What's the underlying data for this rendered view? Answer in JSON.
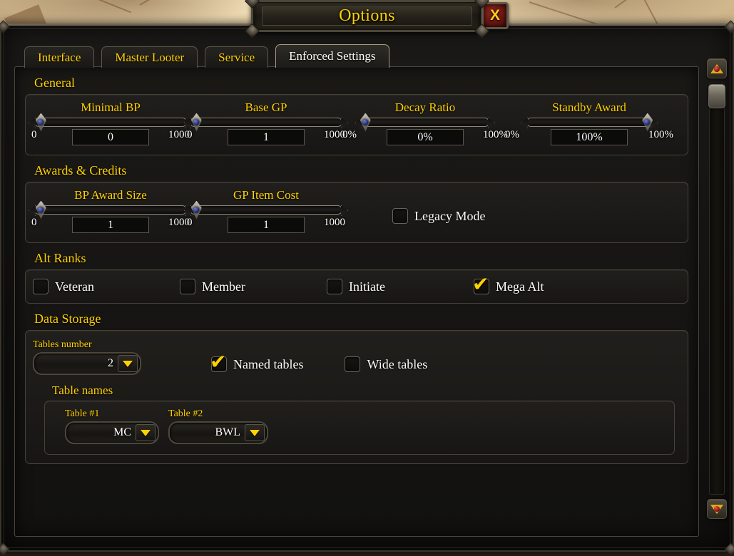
{
  "window": {
    "title": "Options",
    "close_label": "X",
    "close_icon": "close-icon"
  },
  "tabs": [
    {
      "label": "Interface",
      "active": false
    },
    {
      "label": "Master Looter",
      "active": false
    },
    {
      "label": "Service",
      "active": false
    },
    {
      "label": "Enforced Settings",
      "active": true
    }
  ],
  "sections": {
    "general": {
      "title": "General",
      "sliders": [
        {
          "label": "Minimal BP",
          "min": "0",
          "max": "1000",
          "value": "0",
          "fill": 4
        },
        {
          "label": "Base GP",
          "min": "0",
          "max": "1000",
          "value": "1",
          "fill": 4
        },
        {
          "label": "Decay Ratio",
          "min": "0%",
          "max": "100%",
          "value": "0%",
          "fill": 3
        },
        {
          "label": "Standby Award",
          "min": "0%",
          "max": "100%",
          "value": "100%",
          "fill": 97
        }
      ]
    },
    "awards": {
      "title": "Awards & Credits",
      "sliders": [
        {
          "label": "BP Award Size",
          "min": "0",
          "max": "1000",
          "value": "1",
          "fill": 4
        },
        {
          "label": "GP Item Cost",
          "min": "0",
          "max": "1000",
          "value": "1",
          "fill": 4
        }
      ],
      "checkbox": {
        "label": "Legacy Mode",
        "checked": false
      }
    },
    "alt_ranks": {
      "title": "Alt Ranks",
      "checkboxes": [
        {
          "label": "Veteran",
          "checked": false
        },
        {
          "label": "Member",
          "checked": false
        },
        {
          "label": "Initiate",
          "checked": false
        },
        {
          "label": "Mega Alt",
          "checked": true
        }
      ]
    },
    "data_storage": {
      "title": "Data Storage",
      "tables_number": {
        "label": "Tables number",
        "value": "2"
      },
      "checkboxes": [
        {
          "label": "Named tables",
          "checked": true
        },
        {
          "label": "Wide tables",
          "checked": false
        }
      ],
      "table_names": {
        "title": "Table names",
        "entries": [
          {
            "label": "Table #1",
            "value": "MC"
          },
          {
            "label": "Table #2",
            "value": "BWL"
          }
        ]
      }
    }
  },
  "scrollbar": {
    "up_icon": "scroll-up-arrow-icon",
    "down_icon": "scroll-down-arrow-icon"
  },
  "colors": {
    "gold": "#ffd100",
    "text": "#fdfcf8",
    "panel_border": "#474238",
    "close_red": "#6d1712"
  },
  "glyphs": {
    "check": "✔"
  }
}
